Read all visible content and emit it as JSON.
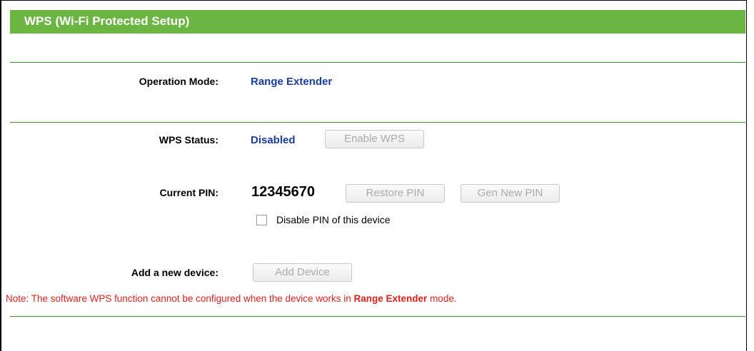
{
  "header": {
    "title": "WPS (Wi-Fi Protected Setup)"
  },
  "operation_mode": {
    "label": "Operation Mode:",
    "value": "Range Extender"
  },
  "wps_status": {
    "label": "WPS Status:",
    "value": "Disabled",
    "button": "Enable WPS"
  },
  "current_pin": {
    "label": "Current PIN:",
    "value": "12345670",
    "restore_button": "Restore PIN",
    "gen_button": "Gen New PIN",
    "checkbox_label": "Disable PIN of this device",
    "checkbox_checked": false
  },
  "add_device": {
    "label": "Add a new device:",
    "button": "Add Device"
  },
  "note": {
    "prefix": "Note",
    "text_before": ": The software WPS function cannot be configured when the device works in ",
    "highlight": "Range Extender",
    "text_after": " mode."
  },
  "colors": {
    "header_green": "#6bb542",
    "value_blue": "#1a3c9c",
    "note_red": "#e0211b"
  }
}
